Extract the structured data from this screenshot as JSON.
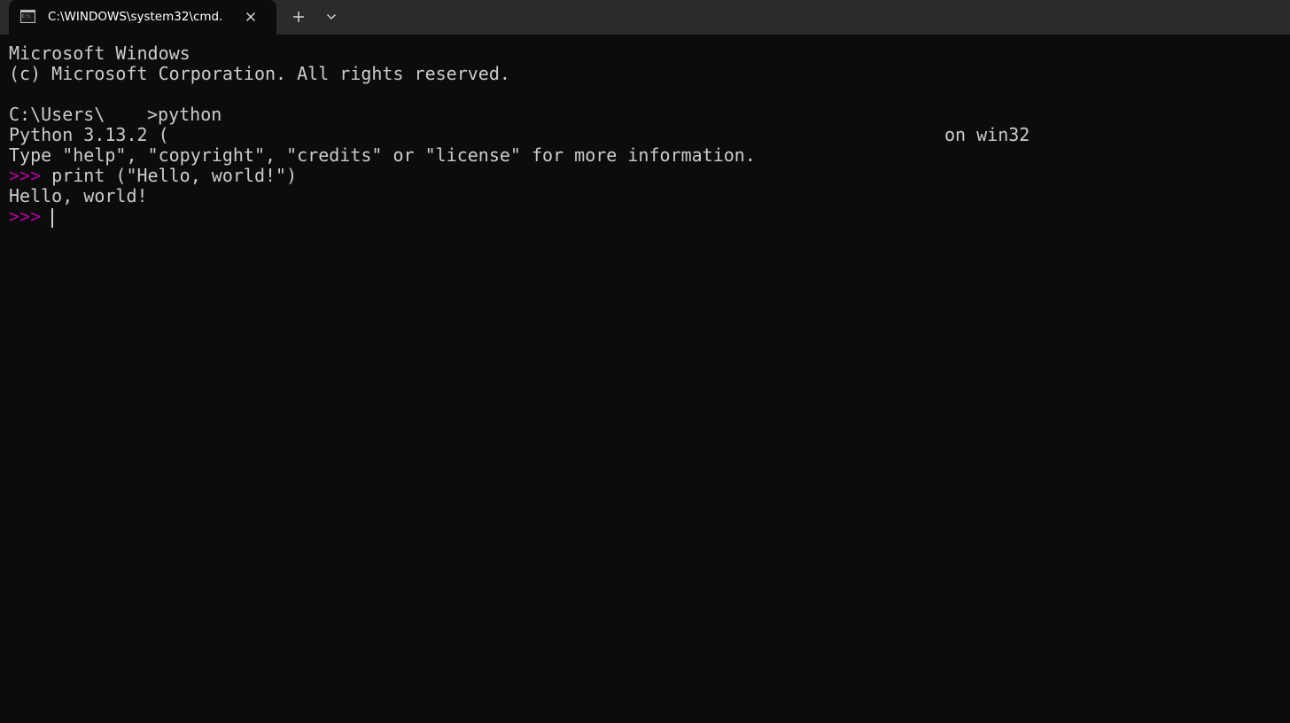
{
  "window": {
    "tab_title": "C:\\WINDOWS\\system32\\cmd.",
    "tab_icon": "cmd-icon",
    "close_icon": "close-icon",
    "new_tab_icon": "plus-icon",
    "dropdown_icon": "chevron-down-icon"
  },
  "colors": {
    "titlebar": "#2b2b2b",
    "background": "#0c0c0c",
    "text": "#cccccc",
    "prompt": "#b4009e"
  },
  "console": {
    "banner_line1": "Microsoft Windows",
    "banner_line2": "(c) Microsoft Corporation. All rights reserved.",
    "cwd_prefix": "C:\\Users\\",
    "command_prefix": ">python",
    "python_version": "Python 3.13.2 (",
    "platform": "on win32",
    "help_line": "Type \"help\", \"copyright\", \"credits\" or \"license\" for more information.",
    "prompt": ">>>",
    "statement": "print (\"Hello, world!\")",
    "output": "Hello, world!",
    "prompt2": ">>>"
  }
}
